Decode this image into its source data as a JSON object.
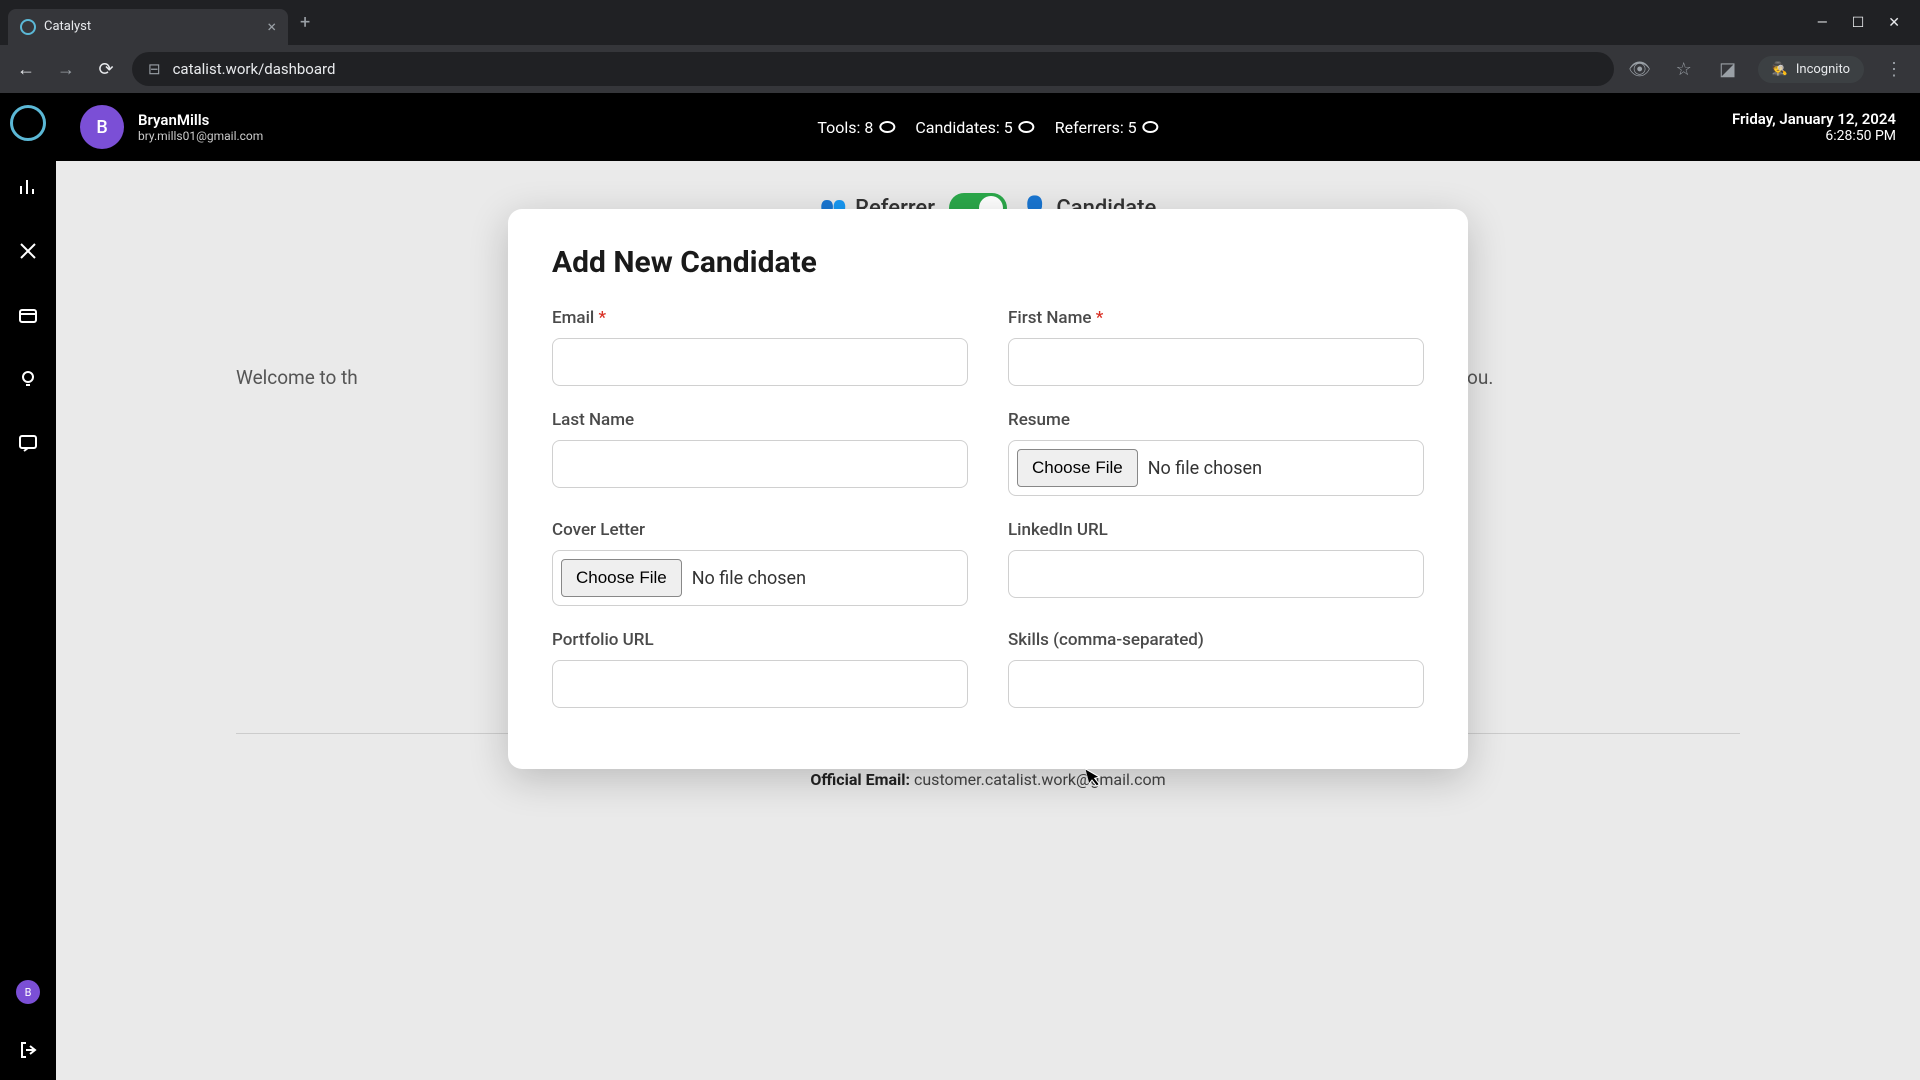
{
  "browser": {
    "tab_title": "Catalyst",
    "url": "catalist.work/dashboard",
    "incognito_label": "Incognito"
  },
  "header": {
    "user_initial": "B",
    "user_name": "BryanMills",
    "user_email": "bry.mills01@gmail.com",
    "stats": {
      "tools_label": "Tools: 8",
      "candidates_label": "Candidates: 5",
      "referrers_label": "Referrers: 5"
    },
    "date": "Friday, January 12, 2024",
    "time": "6:28:50 PM"
  },
  "toggle": {
    "left_label": "Referrer",
    "right_label": "Candidate"
  },
  "welcome_left": "Welcome to th",
  "welcome_right": "ested a referral from you.",
  "modal": {
    "title": "Add New Candidate",
    "email_label": "Email",
    "firstname_label": "First Name",
    "lastname_label": "Last Name",
    "resume_label": "Resume",
    "coverletter_label": "Cover Letter",
    "linkedin_label": "LinkedIn URL",
    "portfolio_label": "Portfolio URL",
    "skills_label": "Skills (comma-separated)",
    "choose_file": "Choose File",
    "no_file": "No file chosen",
    "required": "*"
  },
  "footer": {
    "label": "Official Email:",
    "email": "customer.catalist.work@gmail.com"
  },
  "sidebar_avatar": "B"
}
